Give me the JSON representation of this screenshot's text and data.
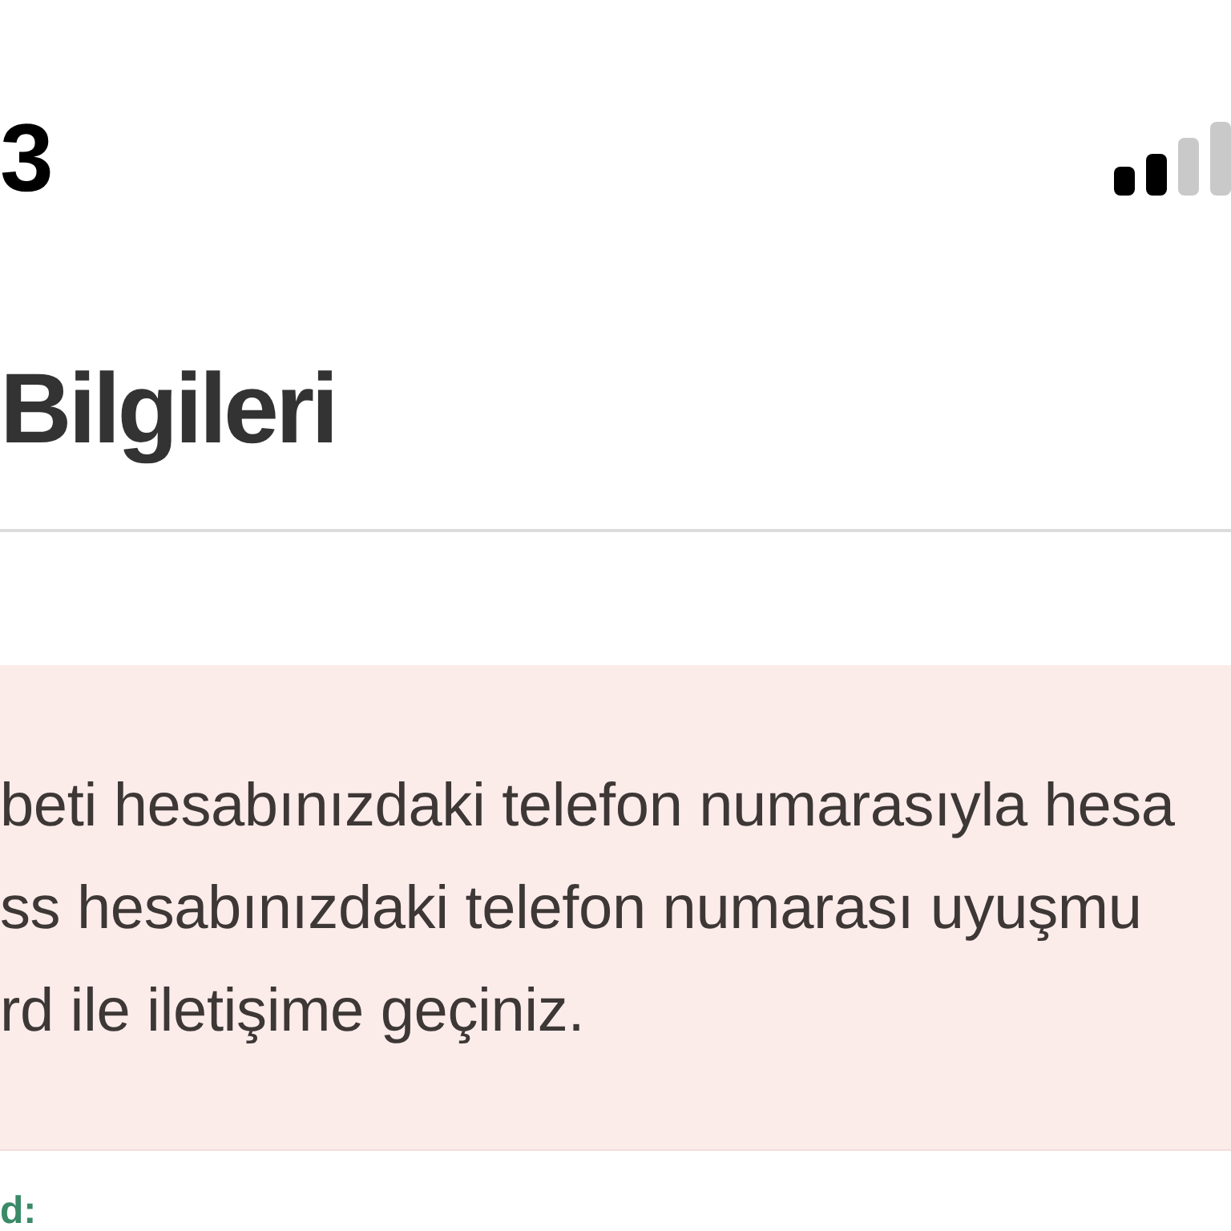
{
  "status_bar": {
    "time": "3"
  },
  "header": {
    "title": "Bilgileri"
  },
  "alert": {
    "lines": [
      "beti hesabınızdaki telefon numarasıyla hesa",
      "ss hesabınızdaki telefon numarası uyuşmu",
      "rd ile iletişime geçiniz."
    ]
  },
  "section_label": "d:"
}
